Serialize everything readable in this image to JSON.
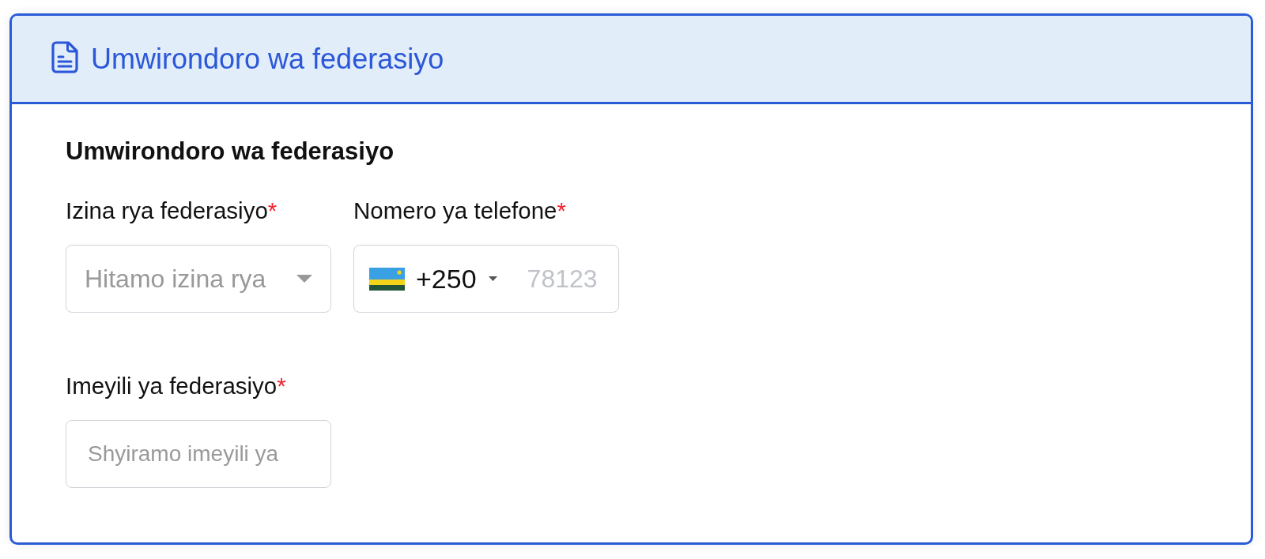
{
  "card": {
    "title": "Umwirondoro wa federasiyo"
  },
  "section": {
    "title": "Umwirondoro wa federasiyo"
  },
  "required_mark": "*",
  "fields": [
    {
      "kind": "select",
      "label": "Izina rya federasiyo",
      "required": true,
      "placeholder": "Hitamo izina rya"
    },
    {
      "kind": "phone",
      "label": "Nomero ya telefone",
      "required": true,
      "country_code": "+250",
      "placeholder": "78123"
    },
    {
      "kind": "text",
      "label": "Imeyili ya federasiyo",
      "required": true,
      "placeholder": "Shyiramo imeyili ya"
    }
  ]
}
